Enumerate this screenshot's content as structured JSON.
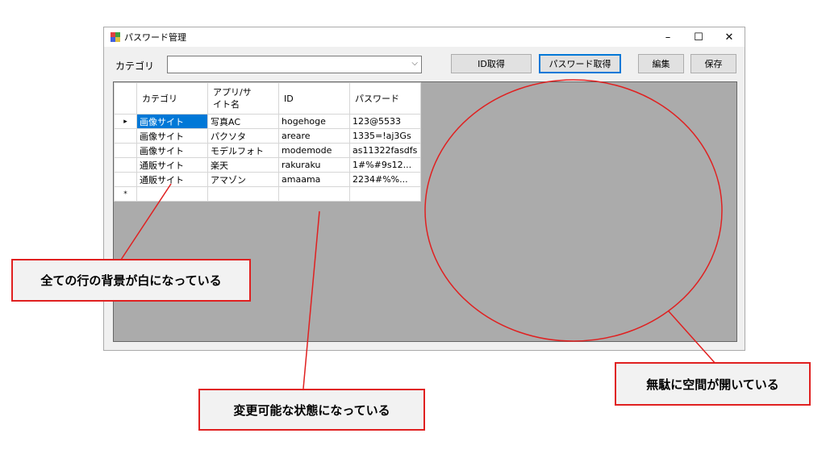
{
  "window": {
    "title": "パスワード管理",
    "controls": {
      "minimize": "–",
      "maximize": "☐",
      "close": "✕"
    }
  },
  "category_label": "カテゴリ",
  "category_select": {
    "value": ""
  },
  "buttons": {
    "id": "ID取得",
    "password": "パスワード取得",
    "edit": "編集",
    "save": "保存"
  },
  "grid": {
    "columns": [
      "カテゴリ",
      "アプリ/サ\nイト名",
      "ID",
      "パスワード"
    ],
    "rows": [
      [
        "画像サイト",
        "写真AC",
        "hogehoge",
        "123@5533"
      ],
      [
        "画像サイト",
        "パクソタ",
        "areare",
        "1335=!aj3Gs"
      ],
      [
        "画像サイト",
        "モデルフォト",
        "modemode",
        "as11322fasdfs"
      ],
      [
        "通販サイト",
        "楽天",
        "rakuraku",
        "1#%#9s12..."
      ],
      [
        "通販サイト",
        "アマゾン",
        "amaama",
        "2234#%%..."
      ]
    ],
    "current_row_marker": "▸",
    "new_row_marker": "*"
  },
  "annotations": {
    "rows_white": "全ての行の背景が白になっている",
    "editable": "変更可能な状態になっている",
    "wasted_space": "無駄に空間が開いている"
  },
  "colors": {
    "annotation_red": "#e02020",
    "selection_blue": "#0078d7",
    "grid_background": "#ababab"
  }
}
